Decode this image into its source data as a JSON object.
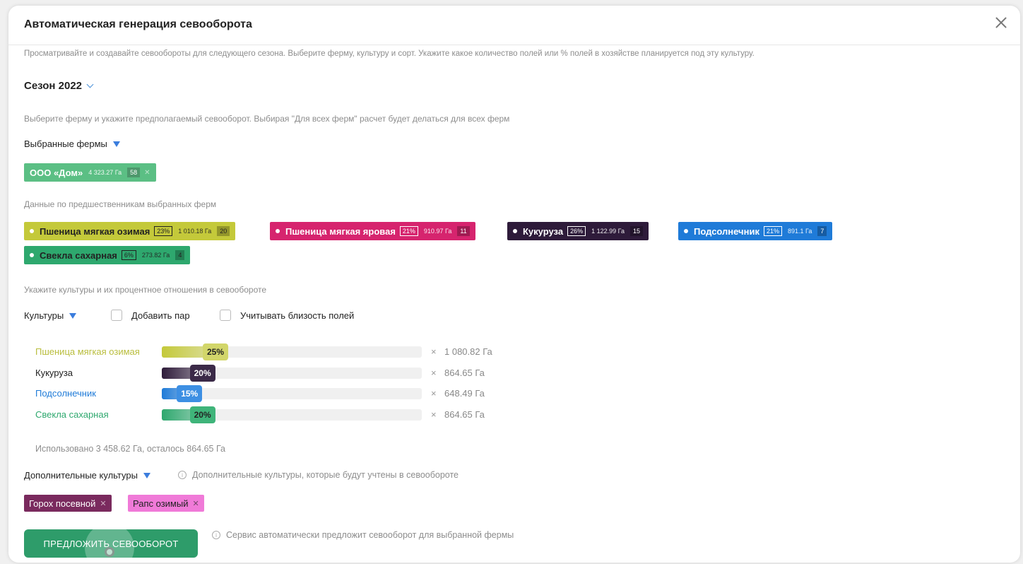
{
  "title": "Автоматическая генерация севооборота",
  "description": "Просматривайте и создавайте севообороты для следующего сезона. Выберите ферму, культуру и сорт. Укажите какое количество полей или % полей в хозяйстве планируется под эту культуру.",
  "season_label": "Сезон 2022",
  "farm_hint": "Выберите ферму и укажите предполагаемый севооборот. Выбирая \"Для всех ферм\" расчет будет делаться для всех ферм",
  "selected_farms_label": "Выбранные фермы",
  "selected_farm": {
    "name": "ООО «Дом»",
    "area": "4 323.27 Га",
    "count": "58",
    "color": "#3fb46f"
  },
  "predecessors_label": "Данные по предшественникам выбранных ферм",
  "predecessors": [
    {
      "name": "Пшеница мягкая озимая",
      "pct": "23%",
      "area": "1 010.18 Га",
      "count": "20",
      "color": "#c4c93a",
      "text": "#222"
    },
    {
      "name": "Пшеница мягкая яровая",
      "pct": "21%",
      "area": "910.97 Га",
      "count": "11",
      "color": "#d6246e",
      "text": "#fff"
    },
    {
      "name": "Кукуруза",
      "pct": "26%",
      "area": "1 122.99 Га",
      "count": "15",
      "color": "#2e1b3a",
      "text": "#fff"
    },
    {
      "name": "Подсолнечник",
      "pct": "21%",
      "area": "891.1 Га",
      "count": "7",
      "color": "#1f7bd8",
      "text": "#fff"
    },
    {
      "name": "Свекла сахарная",
      "pct": "6%",
      "area": "273.82 Га",
      "count": "4",
      "color": "#2ea86e",
      "text": "#222"
    }
  ],
  "crops_hint": "Укажите культуры и их процентное отношения в севообороте",
  "crops_label": "Культуры",
  "add_fallow_label": "Добавить пар",
  "field_proximity_label": "Учитывать близость полей",
  "crops": [
    {
      "name": "Пшеница мягкая озимая",
      "percent": 25,
      "percent_label": "25%",
      "area": "1 080.82 Га",
      "color": "#c4c93a",
      "name_color": "#b9bd3c",
      "badge_bg": "#d2d66a",
      "badge_text": "#222"
    },
    {
      "name": "Кукуруза",
      "percent": 20,
      "percent_label": "20%",
      "area": "864.65 Га",
      "color": "#2e1b3a",
      "name_color": "#222",
      "badge_bg": "#3b2a48",
      "badge_text": "#fff"
    },
    {
      "name": "Подсолнечник",
      "percent": 15,
      "percent_label": "15%",
      "area": "648.49 Га",
      "color": "#1f7bd8",
      "name_color": "#1f7bd8",
      "badge_bg": "#3d8fe3",
      "badge_text": "#fff"
    },
    {
      "name": "Свекла сахарная",
      "percent": 20,
      "percent_label": "20%",
      "area": "864.65 Га",
      "color": "#2ea86e",
      "name_color": "#2ea86e",
      "badge_bg": "#3fb47a",
      "badge_text": "#222"
    }
  ],
  "times_symbol": "×",
  "used_text": "Использовано 3 458.62 Га, осталось 864.65 Га",
  "extra_crops_label": "Дополнительные культуры",
  "extra_crops_hint": "Дополнительные культуры, которые будут учтены в севообороте",
  "extra_crops": [
    {
      "name": "Горох посевной",
      "color": "#7a2a5e",
      "text": "#fff"
    },
    {
      "name": "Рапс озимый",
      "color": "#f07ad8",
      "text": "#222"
    }
  ],
  "submit_label": "ПРЕДЛОЖИТЬ СЕВООБОРОТ",
  "submit_hint": "Сервис автоматически предложит севооборот для выбранной фермы"
}
